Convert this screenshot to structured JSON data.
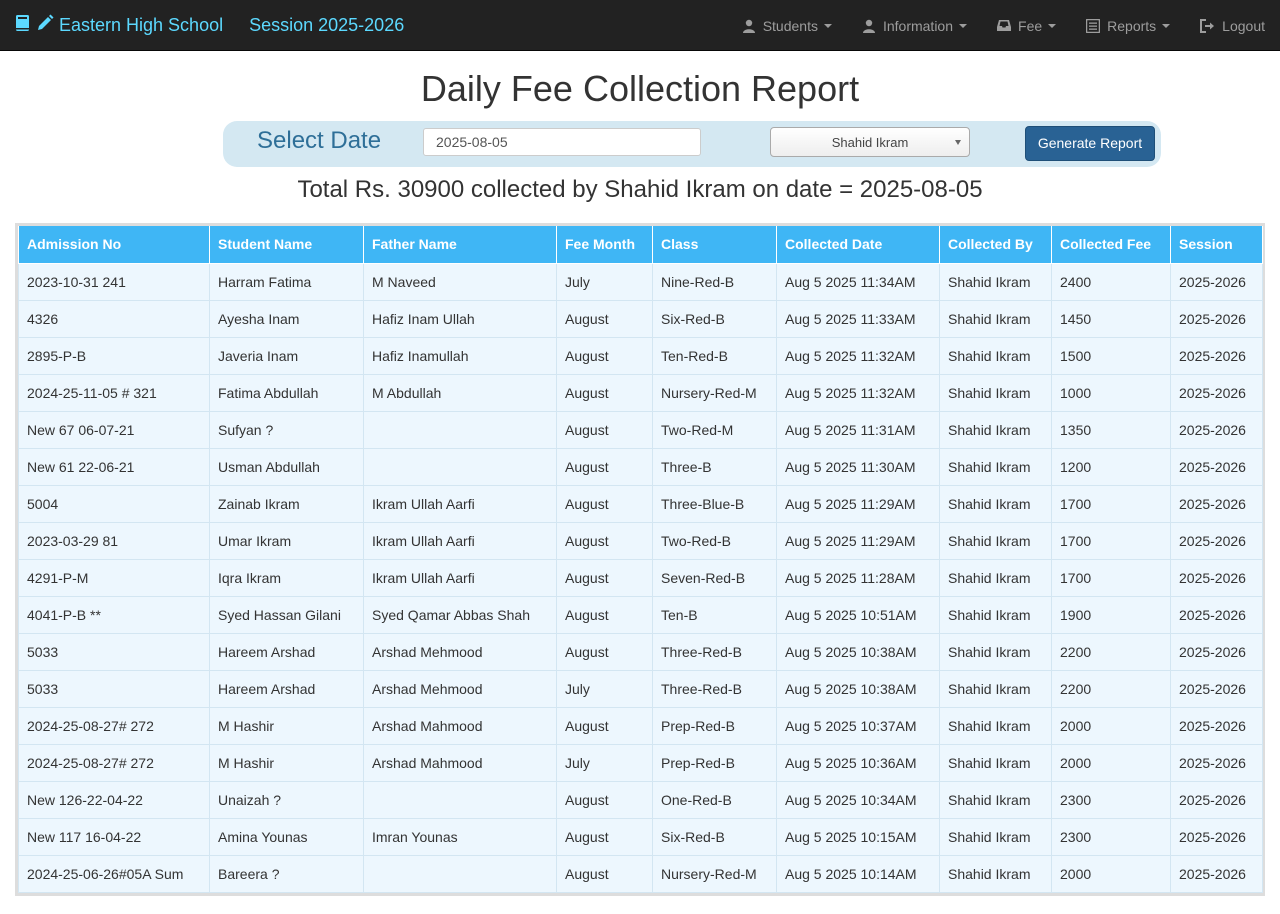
{
  "navbar": {
    "brand_title": "Eastern High School",
    "session_label": "Session 2025-2026",
    "items": [
      {
        "label": "Students",
        "icon": "user-icon"
      },
      {
        "label": "Information",
        "icon": "user-icon"
      },
      {
        "label": "Fee",
        "icon": "inbox-icon"
      },
      {
        "label": "Reports",
        "icon": "list-alt-icon"
      },
      {
        "label": "Logout",
        "icon": "log-out-icon"
      }
    ]
  },
  "page": {
    "title": "Daily Fee Collection Report"
  },
  "filter": {
    "date_label": "Select Date",
    "date_value": "2025-08-05",
    "collector_selected": "Shahid Ikram",
    "generate_button": "Generate Report"
  },
  "summary": {
    "text": "Total Rs. 30900 collected by Shahid Ikram on date = 2025-08-05"
  },
  "table": {
    "headers": [
      "Admission No",
      "Student Name",
      "Father Name",
      "Fee Month",
      "Class",
      "Collected Date",
      "Collected By",
      "Collected Fee",
      "Session"
    ],
    "rows": [
      [
        "2023-10-31 241",
        "Harram Fatima",
        "M Naveed",
        "July",
        "Nine-Red-B",
        "Aug 5 2025 11:34AM",
        "Shahid Ikram",
        "2400",
        "2025-2026"
      ],
      [
        "4326",
        "Ayesha Inam",
        "Hafiz Inam Ullah",
        "August",
        "Six-Red-B",
        "Aug 5 2025 11:33AM",
        "Shahid Ikram",
        "1450",
        "2025-2026"
      ],
      [
        "2895-P-B",
        "Javeria Inam",
        "Hafiz Inamullah",
        "August",
        "Ten-Red-B",
        "Aug 5 2025 11:32AM",
        "Shahid Ikram",
        "1500",
        "2025-2026"
      ],
      [
        "2024-25-11-05 # 321",
        "Fatima Abdullah",
        "M Abdullah",
        "August",
        "Nursery-Red-M",
        "Aug 5 2025 11:32AM",
        "Shahid Ikram",
        "1000",
        "2025-2026"
      ],
      [
        "New 67 06-07-21",
        "Sufyan ?",
        "",
        "August",
        "Two-Red-M",
        "Aug 5 2025 11:31AM",
        "Shahid Ikram",
        "1350",
        "2025-2026"
      ],
      [
        "New 61 22-06-21",
        "Usman Abdullah",
        "",
        "August",
        "Three-B",
        "Aug 5 2025 11:30AM",
        "Shahid Ikram",
        "1200",
        "2025-2026"
      ],
      [
        "5004",
        "Zainab Ikram",
        "Ikram Ullah Aarfi",
        "August",
        "Three-Blue-B",
        "Aug 5 2025 11:29AM",
        "Shahid Ikram",
        "1700",
        "2025-2026"
      ],
      [
        "2023-03-29 81",
        "Umar Ikram",
        "Ikram Ullah Aarfi",
        "August",
        "Two-Red-B",
        "Aug 5 2025 11:29AM",
        "Shahid Ikram",
        "1700",
        "2025-2026"
      ],
      [
        "4291-P-M",
        "Iqra Ikram",
        "Ikram Ullah Aarfi",
        "August",
        "Seven-Red-B",
        "Aug 5 2025 11:28AM",
        "Shahid Ikram",
        "1700",
        "2025-2026"
      ],
      [
        "4041-P-B **",
        "Syed Hassan Gilani",
        "Syed Qamar Abbas Shah",
        "August",
        "Ten-B",
        "Aug 5 2025 10:51AM",
        "Shahid Ikram",
        "1900",
        "2025-2026"
      ],
      [
        "5033",
        "Hareem Arshad",
        "Arshad Mehmood",
        "August",
        "Three-Red-B",
        "Aug 5 2025 10:38AM",
        "Shahid Ikram",
        "2200",
        "2025-2026"
      ],
      [
        "5033",
        "Hareem Arshad",
        "Arshad Mehmood",
        "July",
        "Three-Red-B",
        "Aug 5 2025 10:38AM",
        "Shahid Ikram",
        "2200",
        "2025-2026"
      ],
      [
        "2024-25-08-27# 272",
        "M Hashir",
        "Arshad Mahmood",
        "August",
        "Prep-Red-B",
        "Aug 5 2025 10:37AM",
        "Shahid Ikram",
        "2000",
        "2025-2026"
      ],
      [
        "2024-25-08-27# 272",
        "M Hashir",
        "Arshad Mahmood",
        "July",
        "Prep-Red-B",
        "Aug 5 2025 10:36AM",
        "Shahid Ikram",
        "2000",
        "2025-2026"
      ],
      [
        "New 126-22-04-22",
        "Unaizah ?",
        "",
        "August",
        "One-Red-B",
        "Aug 5 2025 10:34AM",
        "Shahid Ikram",
        "2300",
        "2025-2026"
      ],
      [
        "New 117 16-04-22",
        "Amina Younas",
        "Imran Younas",
        "August",
        "Six-Red-B",
        "Aug 5 2025 10:15AM",
        "Shahid Ikram",
        "2300",
        "2025-2026"
      ],
      [
        "2024-25-06-26#05A Sum",
        "Bareera ?",
        "",
        "August",
        "Nursery-Red-M",
        "Aug 5 2025 10:14AM",
        "Shahid Ikram",
        "2000",
        "2025-2026"
      ]
    ]
  },
  "colors": {
    "navbar_bg": "#222222",
    "brand": "#5cd9ff",
    "table_header_bg": "#3fb6f5",
    "table_row_bg": "#edf7fe",
    "button_bg": "#296294",
    "date_bar_bg": "#d4e8f2"
  }
}
